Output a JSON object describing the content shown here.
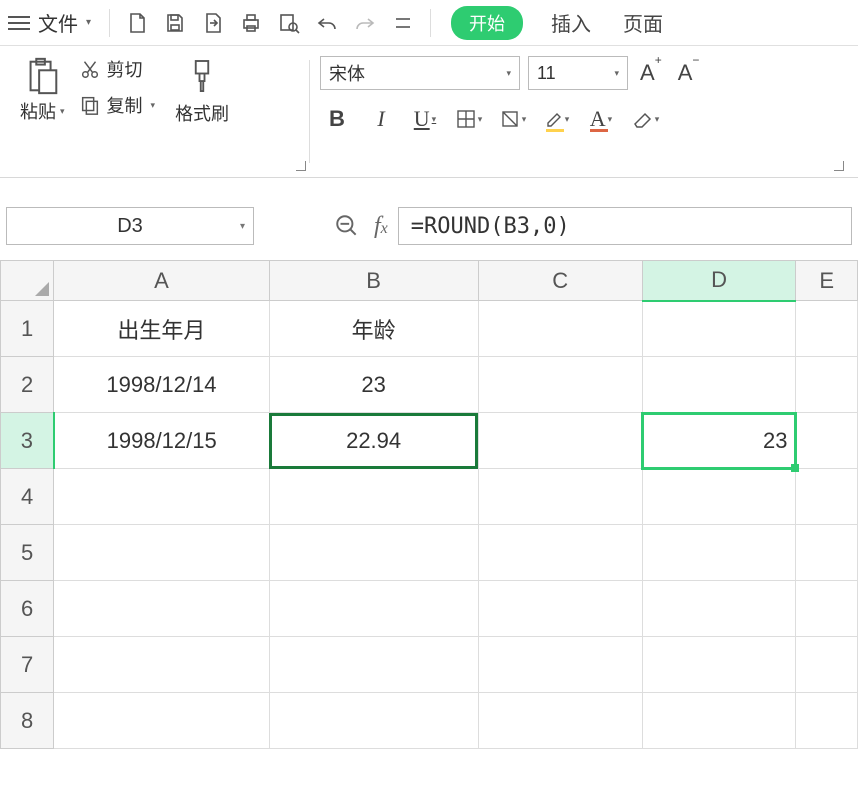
{
  "menu": {
    "file": "文件",
    "tabs": {
      "start": "开始",
      "insert": "插入",
      "page": "页面"
    }
  },
  "ribbon": {
    "paste": "粘贴",
    "cut": "剪切",
    "copy": "复制",
    "format_painter": "格式刷",
    "font_name": "宋体",
    "font_size": "11"
  },
  "formula_bar": {
    "name_box": "D3",
    "formula": "=ROUND(B3,0)"
  },
  "sheet": {
    "columns": [
      "A",
      "B",
      "C",
      "D",
      "E"
    ],
    "rows": [
      "1",
      "2",
      "3",
      "4",
      "5",
      "6",
      "7",
      "8"
    ],
    "selected_col": "D",
    "selected_row": "3",
    "cells": {
      "A1": "出生年月",
      "B1": "年龄",
      "A2": "1998/12/14",
      "B2": "23",
      "A3": "1998/12/15",
      "B3": "22.94",
      "D3": "23"
    }
  }
}
